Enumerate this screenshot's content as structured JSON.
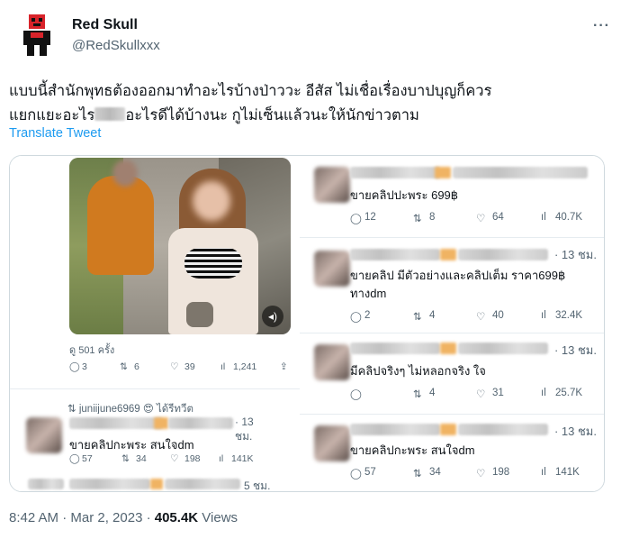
{
  "author": {
    "name": "Red Skull",
    "handle": "@RedSkullxxx"
  },
  "more_label": "···",
  "tweet": {
    "line1": "แบบนี้สำนักพุทธต้องออกมาทำอะไรบ้างป่าววะ อีสัส ไม่เชื่อเรื่องบาปบุญก็ควร",
    "line2_start": "แยกแยะอะไร",
    "line2_end": "อะไรดีได้บ้างนะ กูไม่เซ็นแล้วนะให้นักข่าวตาม",
    "translate": "Translate Tweet"
  },
  "media": {
    "volume_icon": "◂)",
    "views": "ดู 501 ครั้ง",
    "video_stats": {
      "replies": "3",
      "retweets": "6",
      "likes": "39",
      "views": "1,241"
    },
    "retweeted_by": "juniijune6969 😍 ได้รีทวีต",
    "left_reply": {
      "time": "· 13 ชม.",
      "text": "ขายคลิปกะพระ สนใจdm",
      "stats": {
        "replies": "57",
        "retweets": "34",
        "likes": "198",
        "views": "141K"
      }
    },
    "bottom_time": "5 ชม.",
    "right_cards": [
      {
        "time": "",
        "text": "ขายคลิปปะพระ 699฿",
        "stats": {
          "replies": "12",
          "retweets": "8",
          "likes": "64",
          "views": "40.7K"
        }
      },
      {
        "time": "· 13 ชม.",
        "text": "ขายคลิป มีตัวอย่างและคลิปเต็ม ราคา699฿",
        "text2": "ทางdm",
        "stats": {
          "replies": "2",
          "retweets": "4",
          "likes": "40",
          "views": "32.4K"
        }
      },
      {
        "time": "· 13 ชม.",
        "text": "มีคลิปจริงๆ ไม่หลอกจริง ใจ",
        "stats": {
          "replies": "",
          "retweets": "4",
          "likes": "31",
          "views": "25.7K"
        }
      },
      {
        "time": "· 13 ชม.",
        "text": "ขายคลิปกะพระ สนใจdm",
        "stats": {
          "replies": "57",
          "retweets": "34",
          "likes": "198",
          "views": "141K"
        }
      }
    ]
  },
  "footer": {
    "time": "8:42 AM · Mar 2, 2023 · ",
    "views_count": "405.4K",
    "views_label": " Views"
  },
  "icons": {
    "reply": "reply-icon",
    "retweet": "retweet-icon",
    "like": "heart-icon",
    "views": "views-icon",
    "share": "share-icon"
  }
}
